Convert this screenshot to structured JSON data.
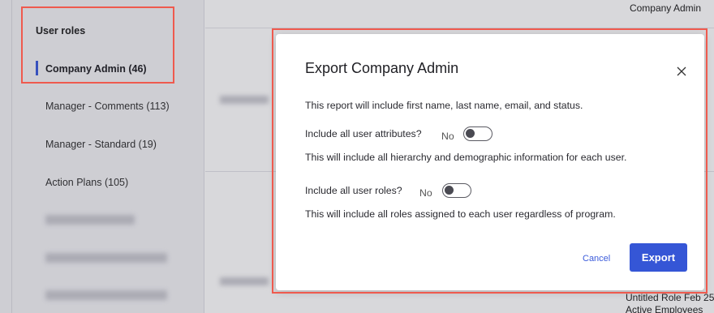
{
  "sidebar": {
    "heading": "User roles",
    "items": [
      {
        "label": "Company Admin",
        "count": "(46)",
        "active": true
      },
      {
        "label": "Manager - Comments",
        "count": "(113)"
      },
      {
        "label": "Manager - Standard",
        "count": "(19)"
      },
      {
        "label": "Action Plans",
        "count": "(105)"
      }
    ]
  },
  "main": {
    "top_right_text": "Company Admin",
    "bottom_texts": [
      "Untitled Role Feb 25",
      "Active Employees"
    ]
  },
  "dialog": {
    "title": "Export Company Admin",
    "intro": "This report will include first name, last name, email, and status.",
    "options": [
      {
        "label": "Include all user attributes?",
        "state": "No",
        "description": "This will include all hierarchy and demographic information for each user."
      },
      {
        "label": "Include all user roles?",
        "state": "No",
        "description": "This will include all roles assigned to each user regardless of program."
      }
    ],
    "cancel_label": "Cancel",
    "export_label": "Export"
  },
  "colors": {
    "accent": "#3556d6",
    "highlight": "#ef5a4e",
    "active_bar": "#3b5bdb"
  }
}
